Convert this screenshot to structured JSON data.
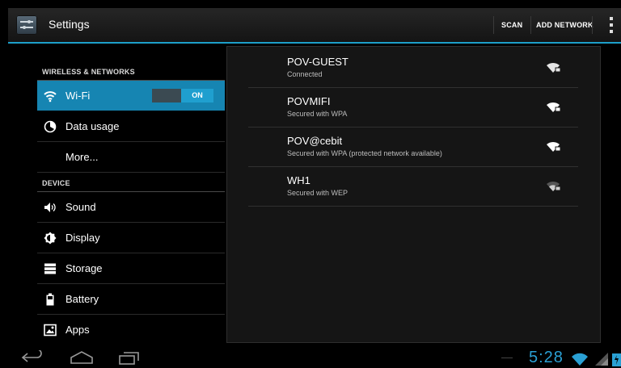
{
  "app": {
    "title": "Settings"
  },
  "actions": {
    "scan": "SCAN",
    "add_network": "ADD NETWORK"
  },
  "colors": {
    "accent": "#1d9fc9",
    "selected": "#1685b2",
    "clock": "#2aa0d4"
  },
  "categories": {
    "wireless": "WIRELESS & NETWORKS",
    "device": "DEVICE"
  },
  "sidebar": {
    "wifi": {
      "label": "Wi-Fi",
      "icon": "wifi-icon",
      "toggle": "ON"
    },
    "data_usage": {
      "label": "Data usage",
      "icon": "data-usage-icon"
    },
    "more": {
      "label": "More..."
    },
    "sound": {
      "label": "Sound",
      "icon": "speaker-icon"
    },
    "display": {
      "label": "Display",
      "icon": "brightness-icon"
    },
    "storage": {
      "label": "Storage",
      "icon": "storage-icon"
    },
    "battery": {
      "label": "Battery",
      "icon": "battery-icon"
    },
    "apps": {
      "label": "Apps",
      "icon": "apps-icon"
    }
  },
  "networks": [
    {
      "ssid": "POV-GUEST",
      "status": "Connected"
    },
    {
      "ssid": "POVMIFI",
      "status": "Secured with WPA"
    },
    {
      "ssid": "POV@cebit",
      "status": "Secured with WPA (protected network available)"
    },
    {
      "ssid": "WH1",
      "status": "Secured with WEP"
    }
  ],
  "statusbar": {
    "time": "5:28"
  }
}
